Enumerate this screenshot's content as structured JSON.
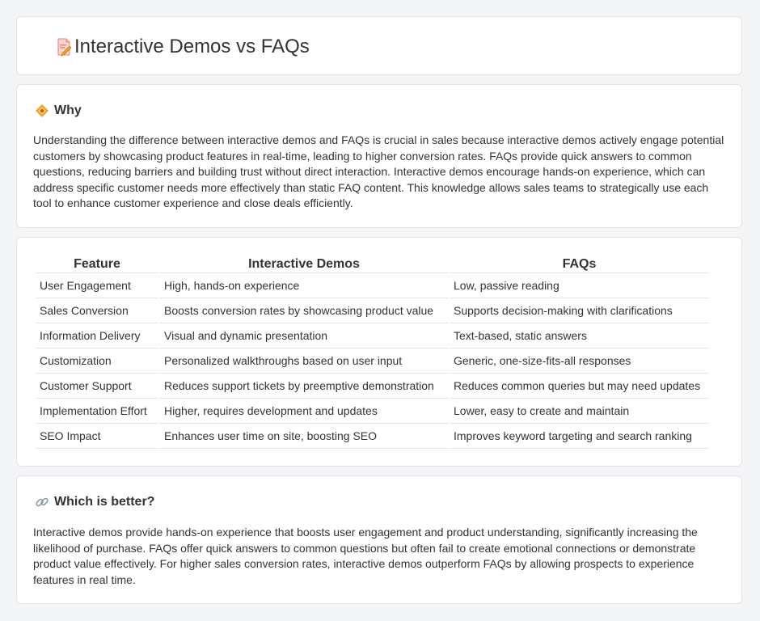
{
  "header": {
    "title": "Interactive Demos vs FAQs",
    "icon": "document-pencil-icon"
  },
  "why": {
    "heading": "Why",
    "icon": "diamond-sign-icon",
    "text": "Understanding the difference between interactive demos and FAQs is crucial in sales because interactive demos actively engage potential customers by showcasing product features in real-time, leading to higher conversion rates. FAQs provide quick answers to common questions, reducing barriers and building trust without direct interaction. Interactive demos encourage hands-on experience, which can address specific customer needs more effectively than static FAQ content. This knowledge allows sales teams to strategically use each tool to enhance customer experience and close deals efficiently."
  },
  "table": {
    "headers": [
      "Feature",
      "Interactive Demos",
      "FAQs"
    ],
    "rows": [
      [
        "User Engagement",
        "High, hands-on experience",
        "Low, passive reading"
      ],
      [
        "Sales Conversion",
        "Boosts conversion rates by showcasing product value",
        "Supports decision-making with clarifications"
      ],
      [
        "Information Delivery",
        "Visual and dynamic presentation",
        "Text-based, static answers"
      ],
      [
        "Customization",
        "Personalized walkthroughs based on user input",
        "Generic, one-size-fits-all responses"
      ],
      [
        "Customer Support",
        "Reduces support tickets by preemptive demonstration",
        "Reduces common queries but may need updates"
      ],
      [
        "Implementation Effort",
        "Higher, requires development and updates",
        "Lower, easy to create and maintain"
      ],
      [
        "SEO Impact",
        "Enhances user time on site, boosting SEO",
        "Improves keyword targeting and search ranking"
      ]
    ]
  },
  "better": {
    "heading": "Which is better?",
    "icon": "link-icon",
    "text": "Interactive demos provide hands-on experience that boosts user engagement and product understanding, significantly increasing the likelihood of purchase. FAQs offer quick answers to common questions but often fail to create emotional connections or demonstrate product value effectively. For higher sales conversion rates, interactive demos outperform FAQs by allowing prospects to experience features in real time."
  },
  "colors": {
    "accent_orange": "#f0a030",
    "icon_pink": "#e8847a",
    "border": "#e1e4e8",
    "background": "#f4f5f7"
  }
}
